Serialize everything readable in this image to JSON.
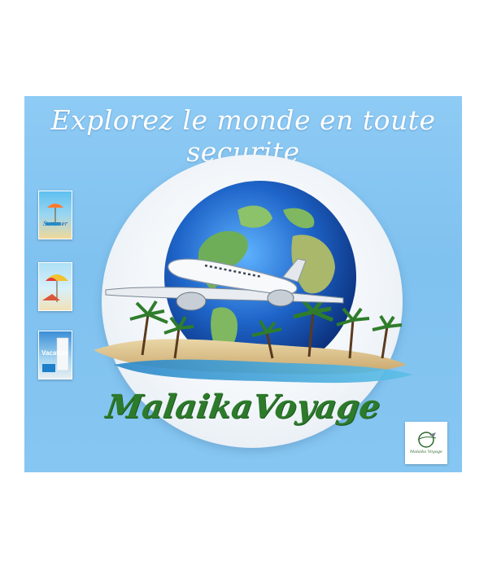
{
  "poster": {
    "headline": "Explorez  le monde en toute securite",
    "brand": "MalaikaVoyage",
    "colors": {
      "sky": "#86c6f2",
      "ocean": "#1e64c8",
      "land": "#6fae58",
      "brand_green": "#2d7a2b",
      "palm": "#2f7d2c"
    }
  },
  "thumbnails": [
    {
      "caption": "Summer",
      "icon": "beach-chair-umbrella"
    },
    {
      "caption": "",
      "icon": "beach-umbrella-palm"
    },
    {
      "caption": "Vacation",
      "icon": "travel-poster"
    }
  ],
  "logo": {
    "text": "Malaika Voyage",
    "icon": "globe-plane-icon"
  }
}
